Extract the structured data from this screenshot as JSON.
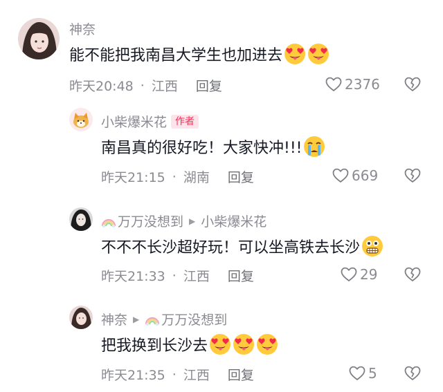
{
  "comments": [
    {
      "user": "神奈",
      "text": "能不能把我南昌大学生也加进去",
      "emojis": [
        "heart-eyes-tongue-emoji",
        "heart-eyes-tongue-emoji"
      ],
      "time": "昨天20:48",
      "location": "江西",
      "reply_label": "回复",
      "likes": "2376"
    },
    {
      "user": "小柴爆米花",
      "badge": "作者",
      "text": "南昌真的很好吃！大家快冲!!!",
      "emojis": [
        "crying-emoji"
      ],
      "time": "昨天21:15",
      "location": "湖南",
      "reply_label": "回复",
      "likes": "669"
    },
    {
      "user": "万万没想到",
      "reply_to": "小柴爆米花",
      "text": "不不不长沙超好玩！可以坐高铁去长沙",
      "emojis": [
        "grinning-teeth-emoji"
      ],
      "time": "昨天21:33",
      "location": "江西",
      "reply_label": "回复",
      "likes": "29"
    },
    {
      "user": "神奈",
      "reply_to": "万万没想到",
      "text": "把我换到长沙去",
      "emojis": [
        "heart-eyes-tongue-emoji",
        "heart-eyes-tongue-emoji",
        "heart-eyes-tongue-emoji"
      ],
      "time": "昨天21:35",
      "location": "江西",
      "reply_label": "回复",
      "likes": "5"
    }
  ],
  "meta_separator": "·",
  "colors": {
    "author_badge_text": "#fe2c55",
    "author_badge_bg": "#fde3ea",
    "secondary_text": "#8a8b91"
  }
}
